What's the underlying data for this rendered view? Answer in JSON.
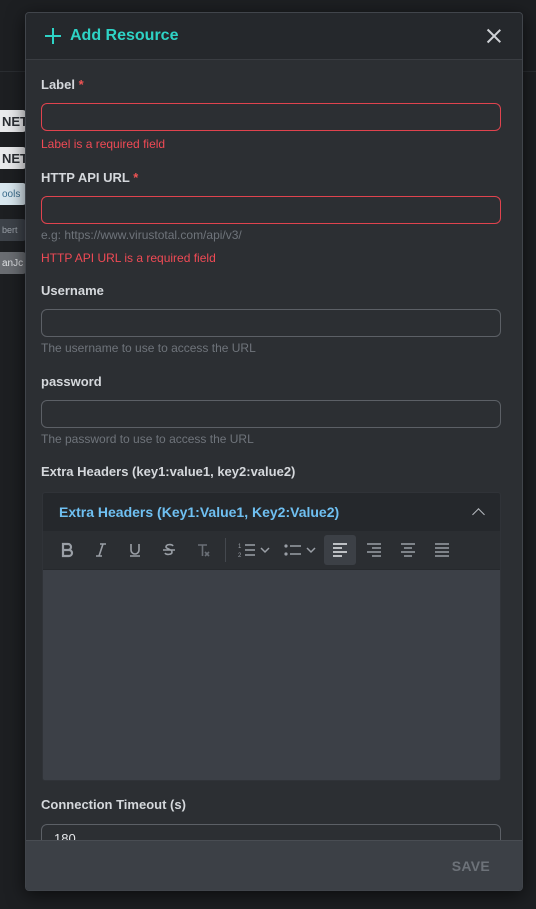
{
  "background": {
    "chips": [
      {
        "text": "NET",
        "bg": "#e9eaec",
        "color": "#2b2e33"
      },
      {
        "text": "NET",
        "bg": "#e9eaec",
        "color": "#2b2e33"
      },
      {
        "text": "ools",
        "bg": "#d9e7ef",
        "color": "#3a6c8c"
      },
      {
        "text": "bert",
        "bg": "#3d4249",
        "color": "#9aa0a8"
      },
      {
        "text": "anJc",
        "bg": "#6a6d72",
        "color": "#dfe1e4"
      }
    ]
  },
  "modal": {
    "title": "Add Resource",
    "save_label": "SAVE"
  },
  "fields": {
    "label": {
      "label": "Label",
      "required_mark": "*",
      "value": "",
      "error": "Label is a required field"
    },
    "http_api_url": {
      "label": "HTTP API URL",
      "required_mark": "*",
      "value": "",
      "hint": "e.g: https://www.virustotal.com/api/v3/",
      "error": "HTTP API URL is a required field"
    },
    "username": {
      "label": "Username",
      "value": "",
      "hint": "The username to use to access the URL"
    },
    "password": {
      "label": "password",
      "value": "",
      "hint": "The password to use to access the URL"
    },
    "extra_headers": {
      "label": "Extra Headers (key1:value1, key2:value2)",
      "editor_title": "Extra Headers (Key1:Value1, Key2:Value2)",
      "value": ""
    },
    "connection_timeout": {
      "label": "Connection Timeout (s)",
      "value": "180"
    }
  },
  "toolbar": {
    "buttons": [
      "bold-icon",
      "italic-icon",
      "underline-icon",
      "strikethrough-icon",
      "clear-format-icon",
      "ordered-list-icon",
      "bullet-list-icon",
      "align-left-icon",
      "align-right-icon",
      "align-center-icon",
      "align-justify-icon"
    ],
    "active": "align-left-icon"
  },
  "colors": {
    "accent": "#2ed3c6",
    "error": "#f04a55",
    "editor_title": "#6fc0f2"
  }
}
